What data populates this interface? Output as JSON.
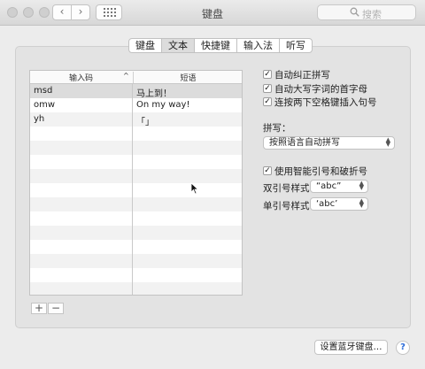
{
  "window": {
    "title": "键盘"
  },
  "toolbar": {
    "back": "‹",
    "forward": "›",
    "search_placeholder": "搜索"
  },
  "tabs": [
    {
      "label": "键盘",
      "active": false
    },
    {
      "label": "文本",
      "active": true
    },
    {
      "label": "快捷键",
      "active": false
    },
    {
      "label": "输入法",
      "active": false
    },
    {
      "label": "听写",
      "active": false
    }
  ],
  "table": {
    "col1_header": "输入码",
    "col2_header": "短语",
    "sort_indicator": "^",
    "rows": [
      {
        "code": "msd",
        "phrase": "马上到！"
      },
      {
        "code": "omw",
        "phrase": "On my way!"
      },
      {
        "code": "yh",
        "phrase": "「」"
      }
    ]
  },
  "table_buttons": {
    "add": "+",
    "remove": "−"
  },
  "options": {
    "autocorrect": {
      "label": "自动纠正拼写",
      "checked": true
    },
    "capitalize": {
      "label": "自动大写字词的首字母",
      "checked": true
    },
    "period_shortcut": {
      "label": "连按两下空格键插入句号",
      "checked": true
    },
    "spelling_label": "拼写：",
    "spelling_value": "按照语言自动拼写",
    "smart_quotes": {
      "label": "使用智能引号和破折号",
      "checked": true
    },
    "double_quotes_label": "双引号样式",
    "double_quotes_value": "“abc”",
    "single_quotes_label": "单引号样式",
    "single_quotes_value": "‘abc’"
  },
  "bluetooth_button": "设置蓝牙键盘…",
  "help_button": "?"
}
